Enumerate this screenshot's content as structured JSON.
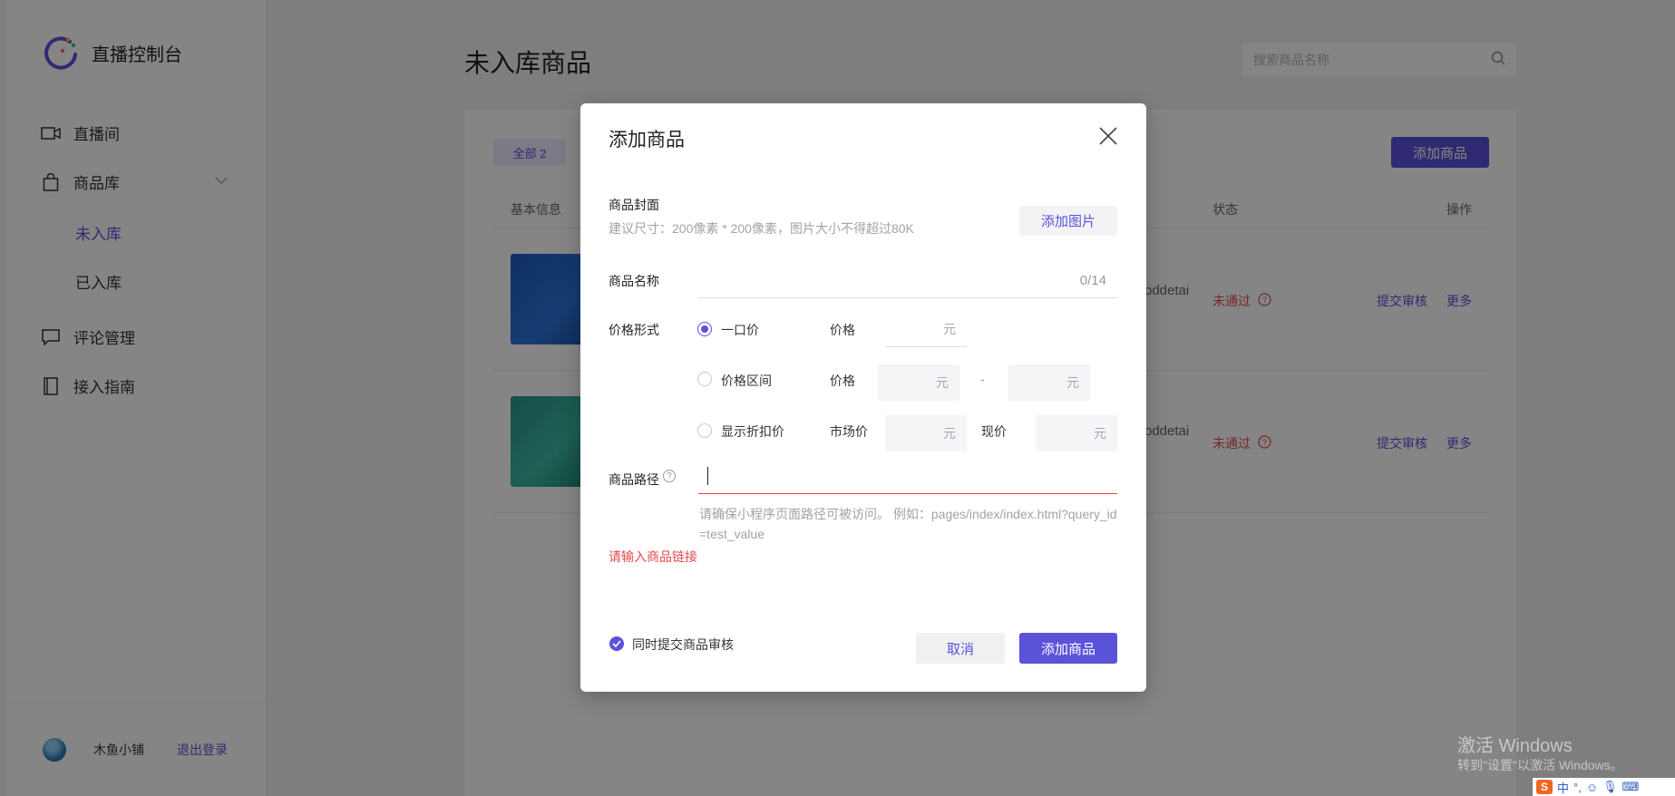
{
  "colors": {
    "accent": "#5a52d8",
    "error": "#e5484d"
  },
  "sidebar": {
    "app_title": "直播控制台",
    "items": [
      {
        "label": "直播间",
        "icon": "video-camera-icon"
      },
      {
        "label": "商品库",
        "icon": "shopping-bag-icon"
      },
      {
        "label": "评论管理",
        "icon": "comment-icon"
      },
      {
        "label": "接入指南",
        "icon": "book-icon"
      }
    ],
    "sub_items": [
      {
        "label": "未入库",
        "active": true
      },
      {
        "label": "已入库",
        "active": false
      }
    ],
    "footer": {
      "shop_name": "木鱼小铺",
      "logout_label": "退出登录"
    }
  },
  "main": {
    "title": "未入库商品",
    "search_placeholder": "搜索商品名称",
    "tab_label": "全部 2",
    "add_button_label": "添加商品",
    "columns": {
      "basic_info": "基本信息",
      "status": "状态",
      "actions": "操作"
    },
    "rows": [
      {
        "path_snippet": "oddetai",
        "status": "未通过",
        "action_submit": "提交审核",
        "action_more": "更多"
      },
      {
        "path_snippet": "oddetai",
        "status": "未通过",
        "action_submit": "提交审核",
        "action_more": "更多"
      }
    ]
  },
  "modal": {
    "title": "添加商品",
    "cover_label": "商品封面",
    "cover_hint": "建议尺寸：200像素 * 200像素，图片大小不得超过80K",
    "add_image_label": "添加图片",
    "name_label": "商品名称",
    "name_counter": "0/14",
    "price_form_label": "价格形式",
    "price_options": [
      {
        "label": "一口价",
        "selected": true
      },
      {
        "label": "价格区间",
        "selected": false
      },
      {
        "label": "显示折扣价",
        "selected": false
      }
    ],
    "price_label": "价格",
    "market_price_label": "市场价",
    "current_price_label": "现价",
    "unit": "元",
    "range_dash": "-",
    "path_label": "商品路径",
    "path_help": "?",
    "path_hint": "请确保小程序页面路径可被访问。 例如：pages/index/index.html?query_id=test_value",
    "path_error": "请输入商品链接",
    "submit_review_label": "同时提交商品审核",
    "submit_review_checked": true,
    "cancel_label": "取消",
    "confirm_label": "添加商品"
  },
  "watermark": {
    "title": "激活 Windows",
    "subtitle": "转到\"设置\"以激活 Windows。"
  },
  "tray": {
    "ime_logo": "S",
    "ime_mode": "中",
    "punct": "°,"
  }
}
